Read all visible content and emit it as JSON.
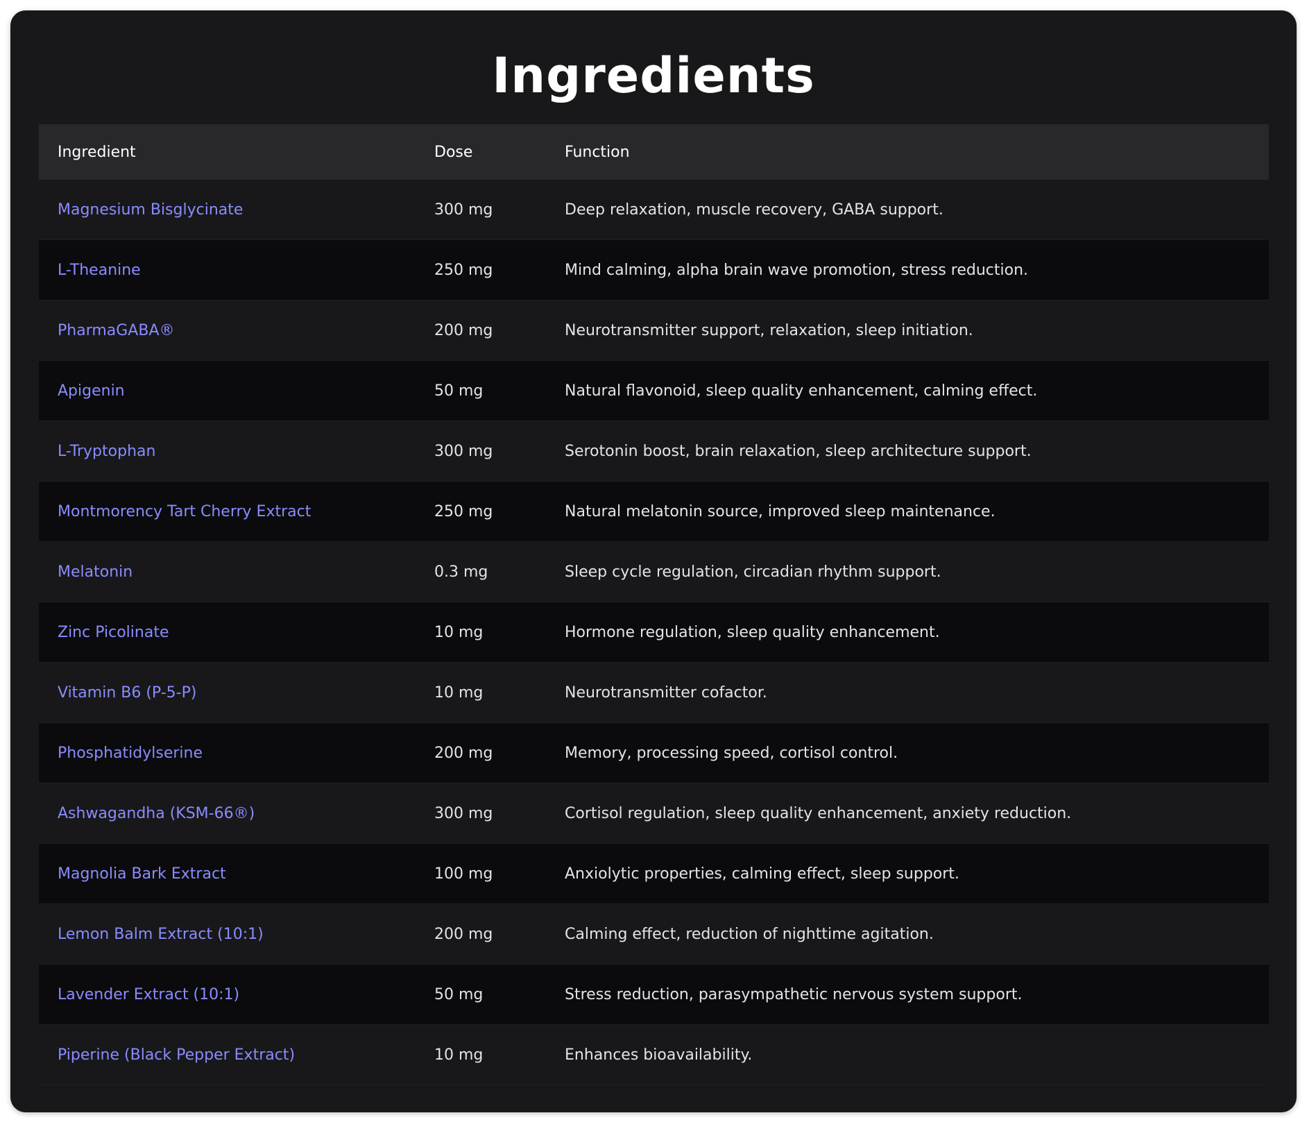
{
  "title": "Ingredients",
  "table": {
    "headers": {
      "ingredient": "Ingredient",
      "dose": "Dose",
      "function": "Function"
    },
    "rows": [
      {
        "ingredient": "Magnesium Bisglycinate",
        "dose": "300 mg",
        "function": "Deep relaxation, muscle recovery, GABA support."
      },
      {
        "ingredient": "L-Theanine",
        "dose": "250 mg",
        "function": "Mind calming, alpha brain wave promotion, stress reduction."
      },
      {
        "ingredient": "PharmaGABA®",
        "dose": "200 mg",
        "function": "Neurotransmitter support, relaxation, sleep initiation."
      },
      {
        "ingredient": "Apigenin",
        "dose": "50 mg",
        "function": "Natural flavonoid, sleep quality enhancement, calming effect."
      },
      {
        "ingredient": "L-Tryptophan",
        "dose": "300 mg",
        "function": "Serotonin boost, brain relaxation, sleep architecture support."
      },
      {
        "ingredient": "Montmorency Tart Cherry Extract",
        "dose": "250 mg",
        "function": "Natural melatonin source, improved sleep maintenance."
      },
      {
        "ingredient": "Melatonin",
        "dose": "0.3 mg",
        "function": "Sleep cycle regulation, circadian rhythm support."
      },
      {
        "ingredient": "Zinc Picolinate",
        "dose": "10 mg",
        "function": "Hormone regulation, sleep quality enhancement."
      },
      {
        "ingredient": "Vitamin B6 (P-5-P)",
        "dose": "10 mg",
        "function": "Neurotransmitter cofactor."
      },
      {
        "ingredient": "Phosphatidylserine",
        "dose": "200 mg",
        "function": "Memory, processing speed, cortisol control."
      },
      {
        "ingredient": "Ashwagandha (KSM-66®)",
        "dose": "300 mg",
        "function": "Cortisol regulation, sleep quality enhancement, anxiety reduction."
      },
      {
        "ingredient": "Magnolia Bark Extract",
        "dose": "100 mg",
        "function": "Anxiolytic properties, calming effect, sleep support."
      },
      {
        "ingredient": "Lemon Balm Extract (10:1)",
        "dose": "200 mg",
        "function": "Calming effect, reduction of nighttime agitation."
      },
      {
        "ingredient": "Lavender Extract (10:1)",
        "dose": "50 mg",
        "function": "Stress reduction, parasympathetic nervous system support."
      },
      {
        "ingredient": "Piperine (Black Pepper Extract)",
        "dose": "10 mg",
        "function": "Enhances bioavailability."
      }
    ]
  },
  "colors": {
    "card_background": "#18181a",
    "header_background": "#28282b",
    "alt_row_background": "#0b0b0d",
    "ingredient_link": "#8a8cff",
    "text": "#e4e4e6"
  }
}
